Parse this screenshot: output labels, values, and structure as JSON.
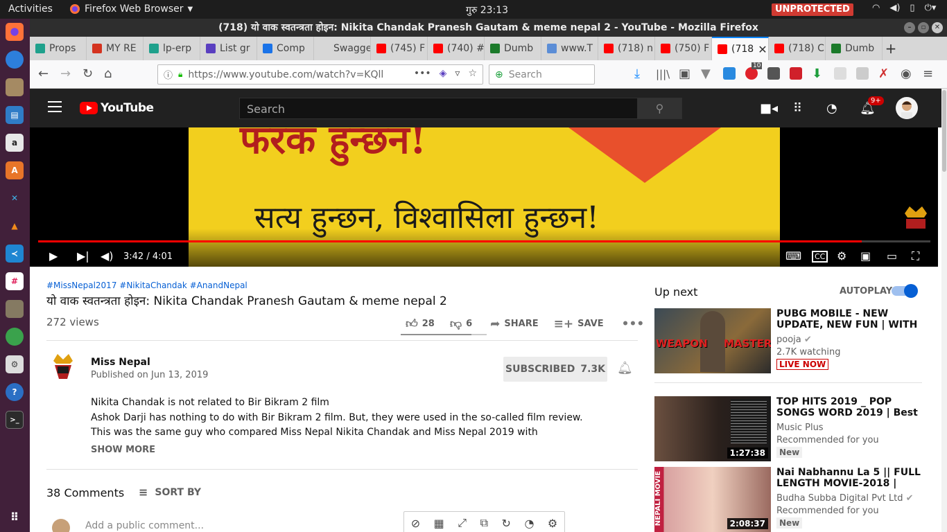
{
  "topbar": {
    "activities": "Activities",
    "app_name": "Firefox Web Browser",
    "clock": "गुरु 23:13",
    "unprotected": "UNPROTECTED",
    "tray_icons": [
      "wifi-icon",
      "volume-icon",
      "battery-icon",
      "power-icon"
    ]
  },
  "dock": {
    "apps": [
      "firefox-icon",
      "thunderbird-icon",
      "files-icon",
      "writer-icon",
      "amazon-icon",
      "software-icon",
      "tools-icon",
      "vlc-icon",
      "vscode-icon",
      "slack-icon",
      "gimp-icon",
      "globe-icon",
      "settings-icon",
      "help-icon",
      "terminal-icon",
      "apps-grid-icon"
    ]
  },
  "window": {
    "title": "(718) यो वाक स्वतन्त्रता होइन: Nikita Chandak Pranesh Gautam & meme nepal 2 - YouTube - Mozilla Firefox"
  },
  "tabs": [
    {
      "label": "Props",
      "color": "#1fa18c"
    },
    {
      "label": "MY RE",
      "color": "#d4331f"
    },
    {
      "label": "lp-erp",
      "color": "#1fa18c"
    },
    {
      "label": "List gr",
      "color": "#5a3fc0"
    },
    {
      "label": "Comp",
      "color": "#1a73e8"
    },
    {
      "label": "Swagger",
      "color": "#d7d7d7"
    },
    {
      "label": "(745) F",
      "color": "#ff0000"
    },
    {
      "label": "(740) #",
      "color": "#ff0000"
    },
    {
      "label": "Dumb",
      "color": "#1b7a2a"
    },
    {
      "label": "www.T",
      "color": "#5b8dd6"
    },
    {
      "label": "(718) n",
      "color": "#ff0000"
    },
    {
      "label": "(750) F",
      "color": "#ff0000"
    },
    {
      "label": "(718",
      "color": "#ff0000",
      "active": true
    },
    {
      "label": "(718) C",
      "color": "#ff0000"
    },
    {
      "label": "Dumb",
      "color": "#1b7a2a"
    }
  ],
  "nav": {
    "url": "https://www.youtube.com/watch?v=KQll",
    "search_placeholder": "Search",
    "ext_badge": "10"
  },
  "youtube": {
    "logo": "YouTube",
    "search_placeholder": "Search",
    "notif_count": "9+",
    "player": {
      "frame_text_top": "फरक हुन्छन!",
      "frame_text_bottom": "सत्य हुन्छन, विश्वासिला हुन्छन!",
      "time": "3:42 / 4:01",
      "progress": 0.923
    },
    "video": {
      "tags": "#MissNepal2017 #NikitaChandak #AnandNepal",
      "title": "यो वाक स्वतन्त्रता होइन: Nikita Chandak Pranesh Gautam & meme nepal 2",
      "views": "272 views",
      "likes": "28",
      "dislikes": "6",
      "share": "SHARE",
      "save": "SAVE",
      "like_ratio": 0.82
    },
    "channel": {
      "name": "Miss Nepal",
      "published": "Published on Jun 13, 2019",
      "subscribed": "SUBSCRIBED",
      "sub_count": "7.3K"
    },
    "description": [
      "Nikita Chandak is not related to Bir Bikram 2 film",
      "Ashok Darji has nothing to do with Bir Bikram 2 film. But, they were used in the so-called film review.",
      "This was the same guy who compared Miss Nepal Nikita Chandak and Miss Nepal 2019 with"
    ],
    "show_more": "SHOW MORE",
    "comments": {
      "count": "38 Comments",
      "sort": "SORT BY",
      "placeholder": "Add a public comment..."
    },
    "sidebar": {
      "up_next": "Up next",
      "autoplay": "AUTOPLAY",
      "items": [
        {
          "title": "PUBG MOBILE - NEW UPDATE, NEW FUN | WITH",
          "channel": "pooja",
          "meta": "2.7K watching",
          "badge": "LIVE NOW",
          "thumb_text_left": "WEAPON",
          "thumb_text_right": "MASTER"
        },
        {
          "title": "TOP HITS 2019 _ POP SONGS WORD 2019 | Best",
          "channel": "Music Plus",
          "meta": "Recommended for you",
          "badge": "New",
          "duration": "1:27:38"
        },
        {
          "title": "Nai Nabhannu La 5 || FULL LENGTH MOVIE-2018 |",
          "channel": "Budha Subba Digital Pvt Ltd",
          "meta": "Recommended for you",
          "badge": "New",
          "duration": "2:08:37",
          "thumb_text": "NEPALI MOVIE"
        }
      ]
    }
  }
}
